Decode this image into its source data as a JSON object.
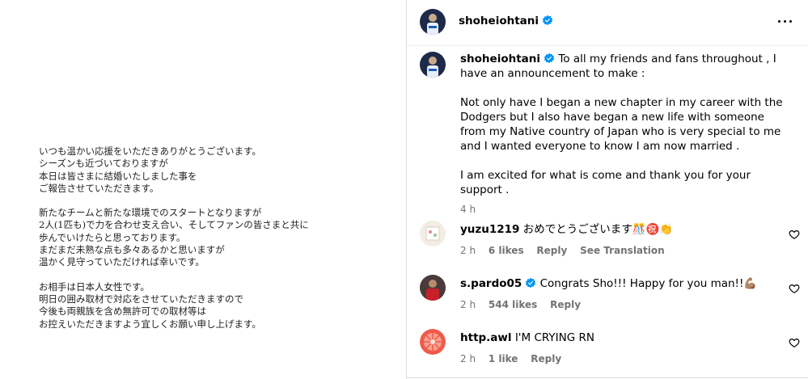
{
  "letter": {
    "paragraphs": [
      "いつも温かい応援をいただきありがとうございます。\nシーズンも近づいておりますが\n本日は皆さまに結婚いたしました事を\nご報告させていただきます。",
      "新たなチームと新たな環境でのスタートとなりますが\n2人(1匹も)で力を合わせ支え合い、そしてファンの皆さまと共に\n歩んでいけたらと思っております。\nまだまだ未熟な点も多々あるかと思いますが\n温かく見守っていただければ幸いです。",
      "お相手は日本人女性です。\n明日の囲み取材で対応をさせていただきますので\n今後も両親族を含め無許可での取材等は\nお控えいただきますよう宜しくお願い申し上げます。"
    ]
  },
  "header": {
    "username": "shoheiohtani"
  },
  "caption": {
    "username": "shoheiohtani",
    "paragraphs": [
      "To all my friends and fans throughout , I have an announcement to make :",
      "Not only have I began a new chapter in my career with the Dodgers but I also have began a new life with someone from my Native country of Japan who is very special to me and I wanted everyone to know I am now married .",
      "I am excited for what is come and thank you for your support ."
    ],
    "time": "4 h"
  },
  "comments": [
    {
      "username": "yuzu1219",
      "text": "おめでとうございます🎊㊗️👏",
      "time": "2 h",
      "likes": "6 likes",
      "reply": "Reply",
      "translate": "See Translation",
      "verified": false
    },
    {
      "username": "s.pardo05",
      "text": "Congrats Sho!!! Happy for you man!!💪🏽",
      "time": "2 h",
      "likes": "544 likes",
      "reply": "Reply",
      "verified": true
    },
    {
      "username": "http.awl",
      "text": "I'M CRYING RN",
      "time": "2 h",
      "likes": "1 like",
      "reply": "Reply",
      "verified": false
    }
  ],
  "colors": {
    "verified": "#0095f6",
    "meta": "#737373"
  },
  "icons": {
    "more": "more-options-icon",
    "heart": "heart-outline-icon",
    "verified": "verified-badge-icon"
  }
}
